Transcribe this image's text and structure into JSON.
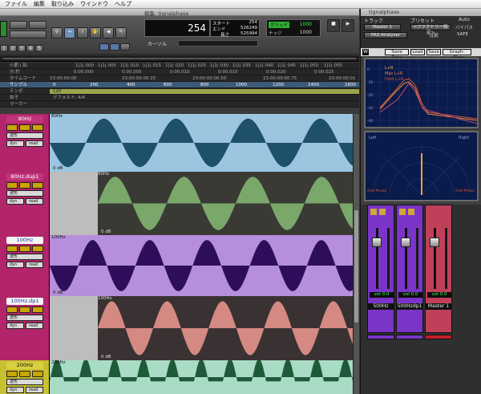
{
  "menu": [
    "ファイル",
    "編集",
    "取り込み",
    "ウインドウ",
    "ヘルプ"
  ],
  "edit_window": {
    "title": "編集: tignalphase"
  },
  "toolbar": {
    "counter_main": "254",
    "counter_start_label": "スタート",
    "counter_end_label": "エンド",
    "counter_length_label": "長さ",
    "start": "254",
    "end": "526249",
    "length": "525994",
    "cursor_label": "カーソル",
    "grid_label": "グリッド",
    "grid_value": "1000",
    "nudge_label": "ナッジ",
    "nudge_value": "1000",
    "nums": [
      "1",
      "2",
      "3",
      "4",
      "5"
    ]
  },
  "rulers": [
    {
      "label": "小節 | 拍",
      "ticks": [
        "1|1| 000",
        "1|1| 005",
        "1|1| 010",
        "1|1| 015",
        "1|1| 020",
        "1|1| 025",
        "1|1| 030",
        "1|1| 035",
        "1|1| 040",
        "1|1| 045",
        "1|1| 050",
        "1|1| 055"
      ]
    },
    {
      "label": "分:秒",
      "ticks": [
        "0:00.000",
        "0:00.005",
        "0:00.010",
        "0:00.015",
        "0:00.020",
        "0:00.025"
      ]
    },
    {
      "label": "タイムコード",
      "ticks": [
        "23:00:00:00",
        "23:00:00:00.25",
        "23:00:00:00.50",
        "23:00:00:00.75",
        "23:00:00:01"
      ]
    },
    {
      "label": "サンプル",
      "ticks": [
        "0",
        "200",
        "400",
        "600",
        "800",
        "1000",
        "1200",
        "1400",
        "1600"
      ]
    },
    {
      "label": "テンポ",
      "ticks": [
        "120"
      ]
    },
    {
      "label": "拍子",
      "ticks": [
        "デフォルト: 4/4"
      ]
    },
    {
      "label": "マーカー",
      "ticks": []
    }
  ],
  "tracks": [
    {
      "name": "80Hz",
      "clip_label": "80Hz",
      "mode": "波形",
      "view": "dyn",
      "view2": "read",
      "db": "0 dB"
    },
    {
      "name": "80Hz.dup1",
      "clip_label": "80Hz",
      "mode": "波形",
      "view": "dyn",
      "view2": "read",
      "db": "0 dB"
    },
    {
      "name": "100Hz",
      "clip_label": "100Hz",
      "mode": "波形",
      "view": "dyn",
      "view2": "read",
      "db": "0 dB"
    },
    {
      "name": "100Hz.dp1",
      "clip_label": "100Hz",
      "mode": "波形",
      "view": "dyn",
      "view2": "read",
      "db": "0 dB"
    },
    {
      "name": "200Hz",
      "clip_label": "200Hz",
      "mode": "波形",
      "view": "dyn",
      "view2": "read",
      "db": ""
    }
  ],
  "plugin": {
    "title": "tignalphase",
    "track_label": "トラック",
    "preset_label": "プリセット",
    "auto_label": "Auto",
    "track_value": "Master 1",
    "plugin_value": "PAZ-Analyzer",
    "preset_value": "<ファクトリー設定>",
    "compare_label": "比較",
    "safe_label": "SAFE",
    "bypass_label": "バイパス",
    "buttons": [
      "Save Data",
      "Load",
      "Save",
      "Graph->Plain"
    ],
    "legend": [
      "L+R",
      "Max L+R",
      "Hold L+R"
    ],
    "ylabels": [
      "0",
      "-10",
      "-20",
      "-30",
      "-40",
      "-50"
    ],
    "xlabels": [
      "16",
      "31",
      "63",
      "125",
      "250",
      "500",
      "1k",
      "2k",
      "4k",
      "8k",
      "16k"
    ],
    "stereo_left": "Left",
    "stereo_right": "Right",
    "anti_phase_left": "Anti-Phase",
    "anti_phase_right": "Anti-Phase",
    "stereo_scale": [
      "-70",
      "-60",
      "-50",
      "-40",
      "-30",
      "-20",
      "-10",
      "0",
      "-10",
      "-20",
      "-30",
      "-40",
      "-50",
      "-60",
      "-70"
    ]
  },
  "mixer": {
    "strips": [
      {
        "name": "500Hz",
        "vol_label": "vol",
        "vol": "0.0",
        "mode": "dyn",
        "color": "#7a35c8"
      },
      {
        "name": "500Hzdp1",
        "vol_label": "vol",
        "vol": "0.0",
        "mode": "dyn",
        "color": "#7a35c8"
      },
      {
        "name": "Master 1",
        "vol_label": "vol",
        "vol": "0.0",
        "mode": "",
        "color": "#c0405a"
      }
    ]
  },
  "colors": {
    "accent_green": "#39ff5a",
    "track_blue": "#9cc6e0",
    "track_green": "#3c3c34",
    "track_purple": "#b58fdb",
    "track_pink": "#3a3232",
    "track_mint": "#a8dcc4"
  }
}
